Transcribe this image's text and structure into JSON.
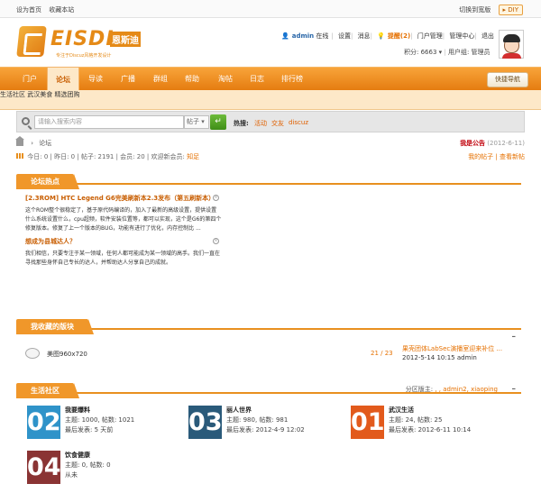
{
  "topbar": {
    "set_home": "设为首页",
    "bookmark": "收藏本站",
    "switch_style": "切换到宽版",
    "diy": "DIY"
  },
  "brand": {
    "name": "EISDL",
    "name_cn": "恩斯迪",
    "tagline": "专注于Discuz风格开发设计",
    "accent_color": "#e58a17"
  },
  "user": {
    "name": "admin",
    "status": "在线",
    "settings": "设置",
    "messages": "消息",
    "reminder": "提醒(2)",
    "portal_mgmt": "门户管理",
    "admin_center": "管理中心",
    "logout": "退出",
    "points": "积分: 6663",
    "group": "用户组: 管理员"
  },
  "nav": {
    "items": [
      "门户",
      "论坛",
      "导读",
      "广播",
      "群组",
      "帮助",
      "淘帖",
      "日志",
      "排行榜"
    ],
    "active": "论坛",
    "quick_nav": "快捷导航"
  },
  "subnav": [
    "生活社区",
    "武汉美食",
    "精选团购"
  ],
  "search": {
    "placeholder": "请输入搜索内容",
    "scope": "帖子",
    "go": "↵",
    "hot_label": "热搜:",
    "hot_words": [
      "活动",
      "交友",
      "discuz"
    ]
  },
  "breadcrumb": {
    "current": "论坛"
  },
  "notice": {
    "title": "我是公告",
    "date": "(2012-6-11)"
  },
  "stats": {
    "today": "今日: 0",
    "yesterday": "昨日: 0",
    "posts": "帖子: 2191",
    "members": "会员: 20",
    "newest_label": "欢迎新会员:",
    "newest": "知足"
  },
  "my_links": {
    "my_posts": "我的帖子",
    "new_posts": "查看新帖"
  },
  "hot_section": {
    "title": "论坛热点",
    "threads": [
      {
        "title": "[2.3ROM] HTC Legend G6完美刷新本2.3发布（第五刷新本）",
        "body": "这个ROM整个很稳定了，基于原代码编译的，加入了最新的高级设置，提供设置什么系统设置什么，cpu超频，软件安装位置等，都可以实现，这个是G6的第四个修复版本。修复了上一个版本的BUG，功能有进行了优化，内存控制比 ..."
      },
      {
        "title": "想成为县城达人？",
        "body": "我们相信，只要专注于某一领域，任何人都可能成为某一领域的高手。我们一直在寻找那些身怀自己专长的达人，并帮助达人分享自己的成就。"
      }
    ]
  },
  "fav_section": {
    "title": "我收藏的版块",
    "forum": "美图960x720",
    "count": "21 / 23",
    "last_title": "果壳团体LabSec演播室迎来补位 ...",
    "last_info": "2012-5-14 10:15 admin"
  },
  "life_section": {
    "title": "生活社区",
    "moderators_label": "分区版主:",
    "moderators": ", , admin2, xiaoping",
    "forums": [
      {
        "num": "02",
        "name": "我要爆料",
        "meta": "主题: 1000, 帖数: 1021",
        "last": "最后发表: 5 天前",
        "color": "#2f93c9"
      },
      {
        "num": "03",
        "name": "丽人世界",
        "meta": "主题: 980, 帖数: 981",
        "last": "最后发表: 2012-4-9 12:02",
        "color": "#2a5a7a"
      },
      {
        "num": "01",
        "name": "武汉生活",
        "meta": "主题: 24, 帖数: 25",
        "last": "最后发表: 2012-6-11 10:14",
        "color": "#e25a1c"
      },
      {
        "num": "04",
        "name": "饮食健康",
        "meta": "主题: 0, 帖数: 0",
        "last": "从未",
        "color": "#8a3434"
      }
    ]
  }
}
